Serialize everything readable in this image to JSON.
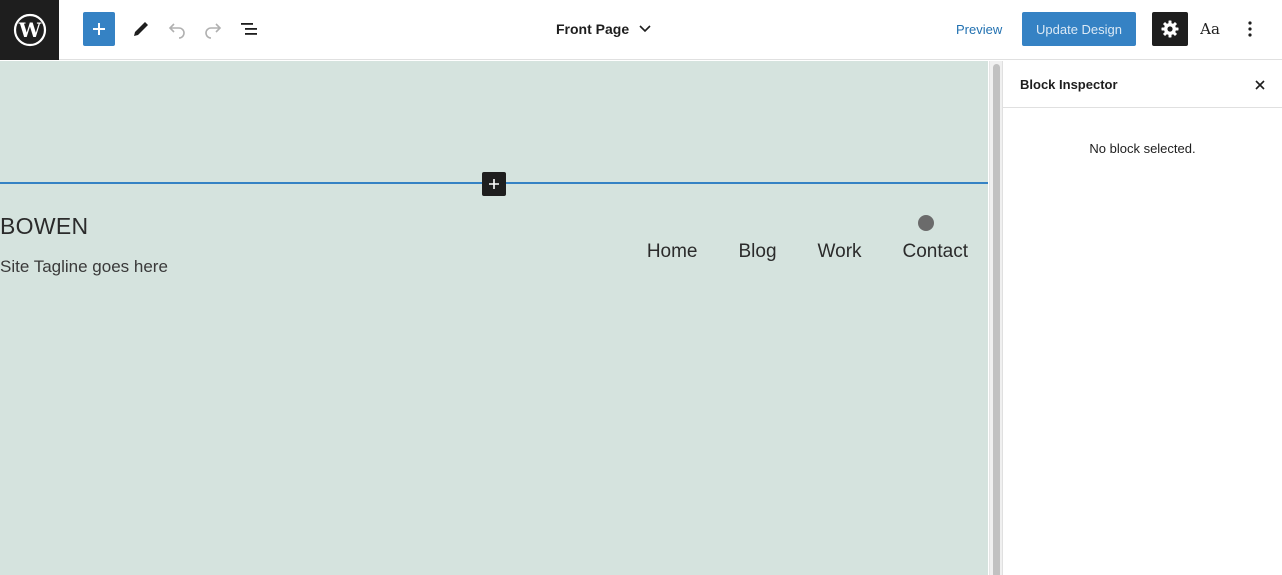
{
  "header": {
    "logo_icon": "wordpress-logo-icon",
    "tools": [
      {
        "name": "add-block",
        "icon": "plus-icon",
        "color": "#3582c4"
      },
      {
        "name": "edit-tools",
        "icon": "pencil-icon"
      },
      {
        "name": "undo",
        "icon": "undo-icon"
      },
      {
        "name": "redo",
        "icon": "redo-icon"
      },
      {
        "name": "list-view",
        "icon": "list-view-icon"
      }
    ],
    "document_title": "Front Page",
    "preview_label": "Preview",
    "update_label": "Update Design",
    "styles_label": "Aa",
    "accent_color": "#3582c4"
  },
  "canvas": {
    "background": "#d5e3de",
    "site_title": "BOWEN",
    "site_tagline": "Site Tagline goes here",
    "nav_items": [
      "Home",
      "Blog",
      "Work",
      "Contact"
    ]
  },
  "sidebar": {
    "title": "Block Inspector",
    "empty_message": "No block selected."
  }
}
